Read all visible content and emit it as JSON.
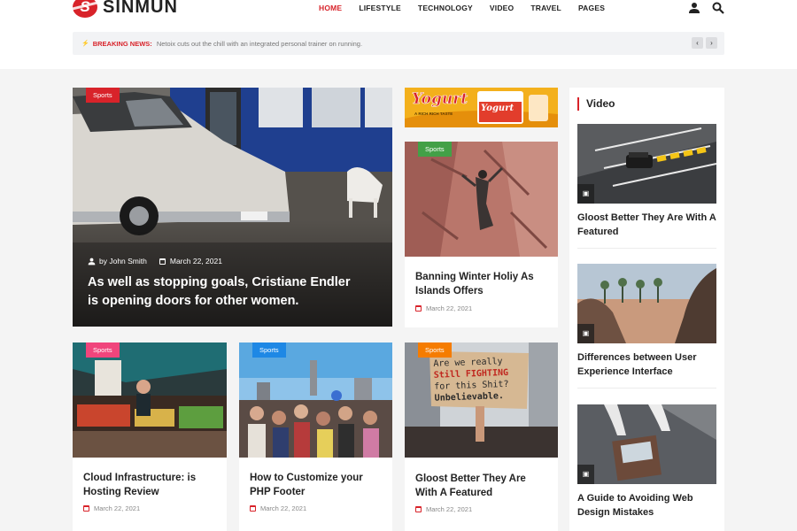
{
  "brand": {
    "name": "SINMUN",
    "mark": "S"
  },
  "nav": [
    "HOME",
    "LIFESTYLE",
    "TECHNOLOGY",
    "VIDEO",
    "TRAVEL",
    "PAGES"
  ],
  "breaking": {
    "label": "BREAKING NEWS:",
    "text": "Netoix cuts out the chill with an integrated personal trainer on running."
  },
  "hero": {
    "tag": "Sports",
    "author": "by John Smith",
    "date": "March 22, 2021",
    "title": "As well as stopping goals, Cristiane Endler is opening doors for other women."
  },
  "ad": {
    "brand": "Yogurt",
    "tagline": "A RICH RICH TASTE"
  },
  "cards": [
    {
      "tag": "Sports",
      "title": "Banning Winter Holiy As Islands Offers",
      "date": "March 22, 2021"
    },
    {
      "tag": "Sports",
      "title": "Cloud Infrastructure: is Hosting Review",
      "date": "March 22, 2021"
    },
    {
      "tag": "Sports",
      "title": "How to Customize your PHP Footer",
      "date": "March 22, 2021"
    },
    {
      "tag": "Sports",
      "title": "Gloost Better They Are With A Featured",
      "date": "March 22, 2021"
    }
  ],
  "protest_sign": [
    "Are we really",
    "Still FIGHTING",
    "for this Shit?",
    "Unbelievable."
  ],
  "sidebar": {
    "heading": "Video",
    "items": [
      {
        "title": "Gloost Better They Are With A Featured"
      },
      {
        "title": "Differences between User Experience Interface"
      },
      {
        "title": "A Guide to Avoiding Web Design Mistakes"
      }
    ]
  },
  "colors": {
    "accent": "#d8232a",
    "tag_red": "#d8232a",
    "tag_green": "#4caf50",
    "tag_pink": "#f0457c",
    "tag_blue": "#1e88e5",
    "tag_orange": "#f57c00"
  }
}
